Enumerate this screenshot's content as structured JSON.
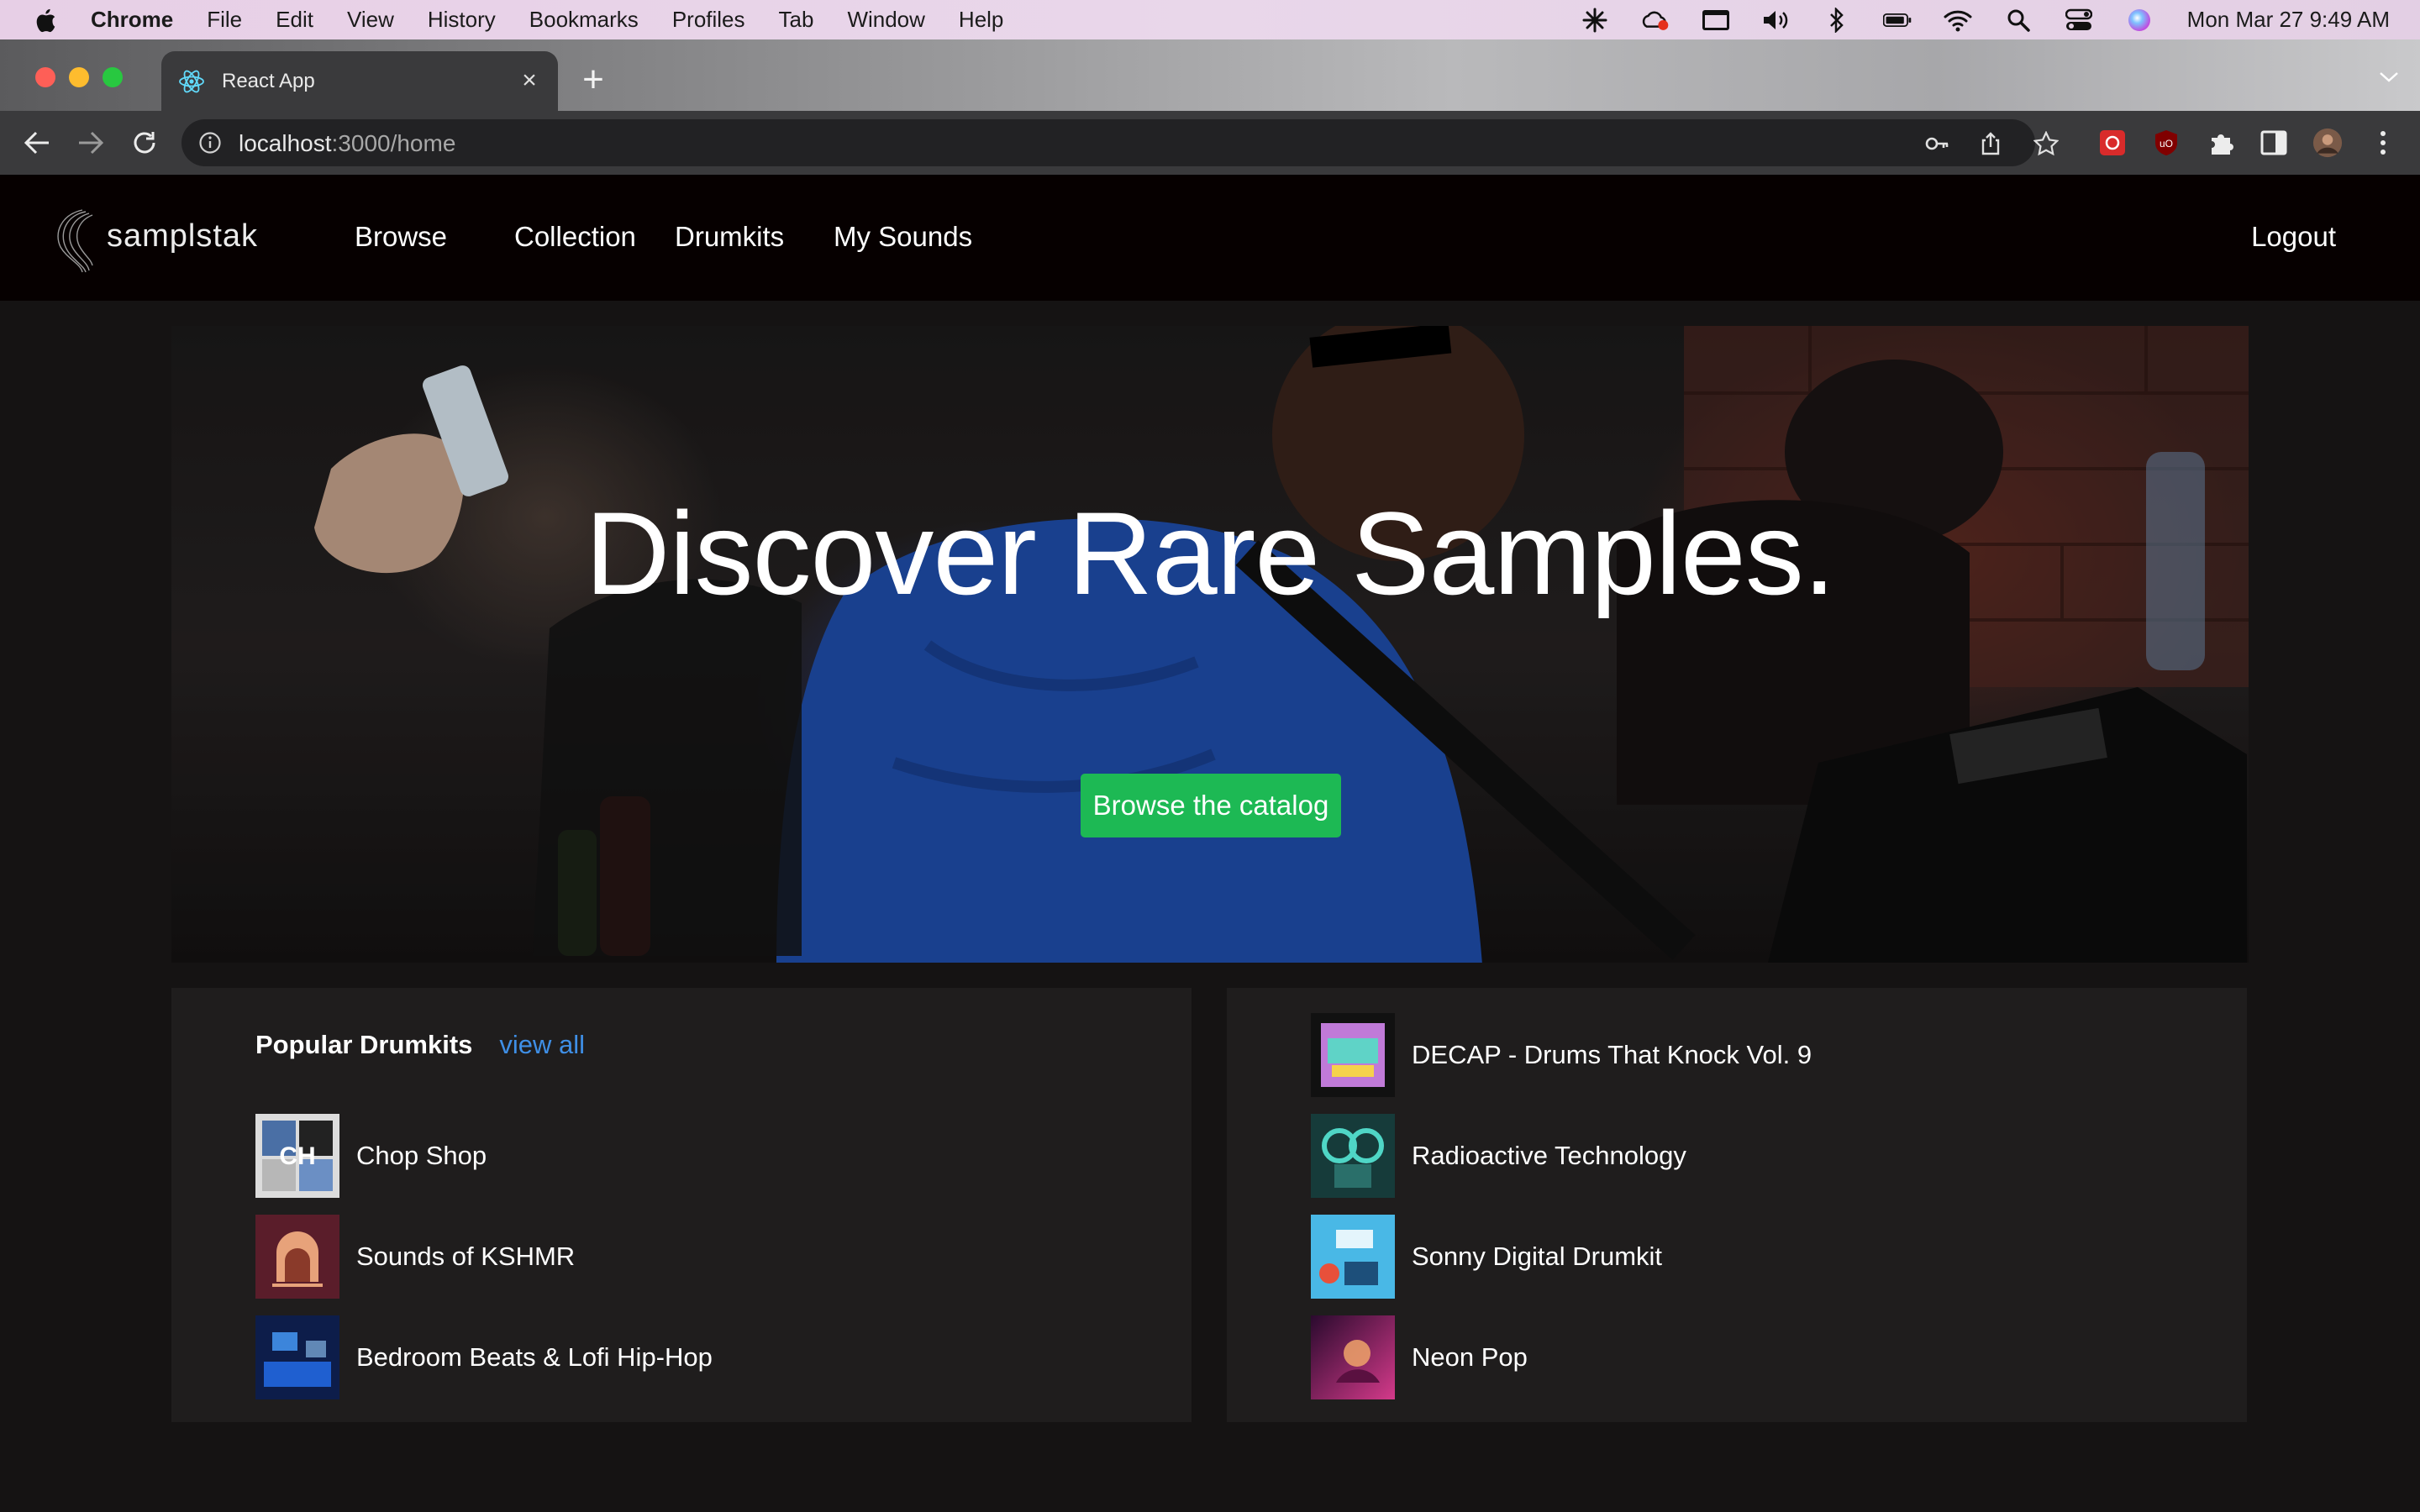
{
  "menubar": {
    "items": [
      "Chrome",
      "File",
      "Edit",
      "View",
      "History",
      "Bookmarks",
      "Profiles",
      "Tab",
      "Window",
      "Help"
    ],
    "clock": "Mon Mar 27  9:49 AM",
    "status_icons": [
      "snowflake-icon",
      "creative-cloud-icon",
      "screen-icon",
      "volume-icon",
      "bluetooth-icon",
      "battery-icon",
      "wifi-icon",
      "spotlight-icon",
      "control-center-icon",
      "siri-icon"
    ]
  },
  "browser": {
    "tab_title": "React App",
    "url_host": "localhost",
    "url_path": ":3000/home"
  },
  "site": {
    "brand": "samplstak",
    "nav": [
      "Browse",
      "Collection",
      "Drumkits",
      "My Sounds"
    ],
    "logout": "Logout"
  },
  "hero": {
    "title": "Discover Rare Samples.",
    "cta": "Browse the catalog"
  },
  "popular": {
    "title": "Popular Drumkits",
    "view_all": "view all",
    "left_items": [
      "Chop Shop",
      "Sounds of KSHMR",
      "Bedroom Beats & Lofi Hip-Hop"
    ],
    "right_items": [
      "DECAP - Drums That Knock Vol. 9",
      "Radioactive Technology",
      "Sonny Digital Drumkit",
      "Neon Pop"
    ]
  },
  "colors": {
    "accent_green": "#1db954",
    "link_blue": "#3f8fe6",
    "nav_bg": "#060000",
    "panel_bg": "#1f1d1d"
  }
}
